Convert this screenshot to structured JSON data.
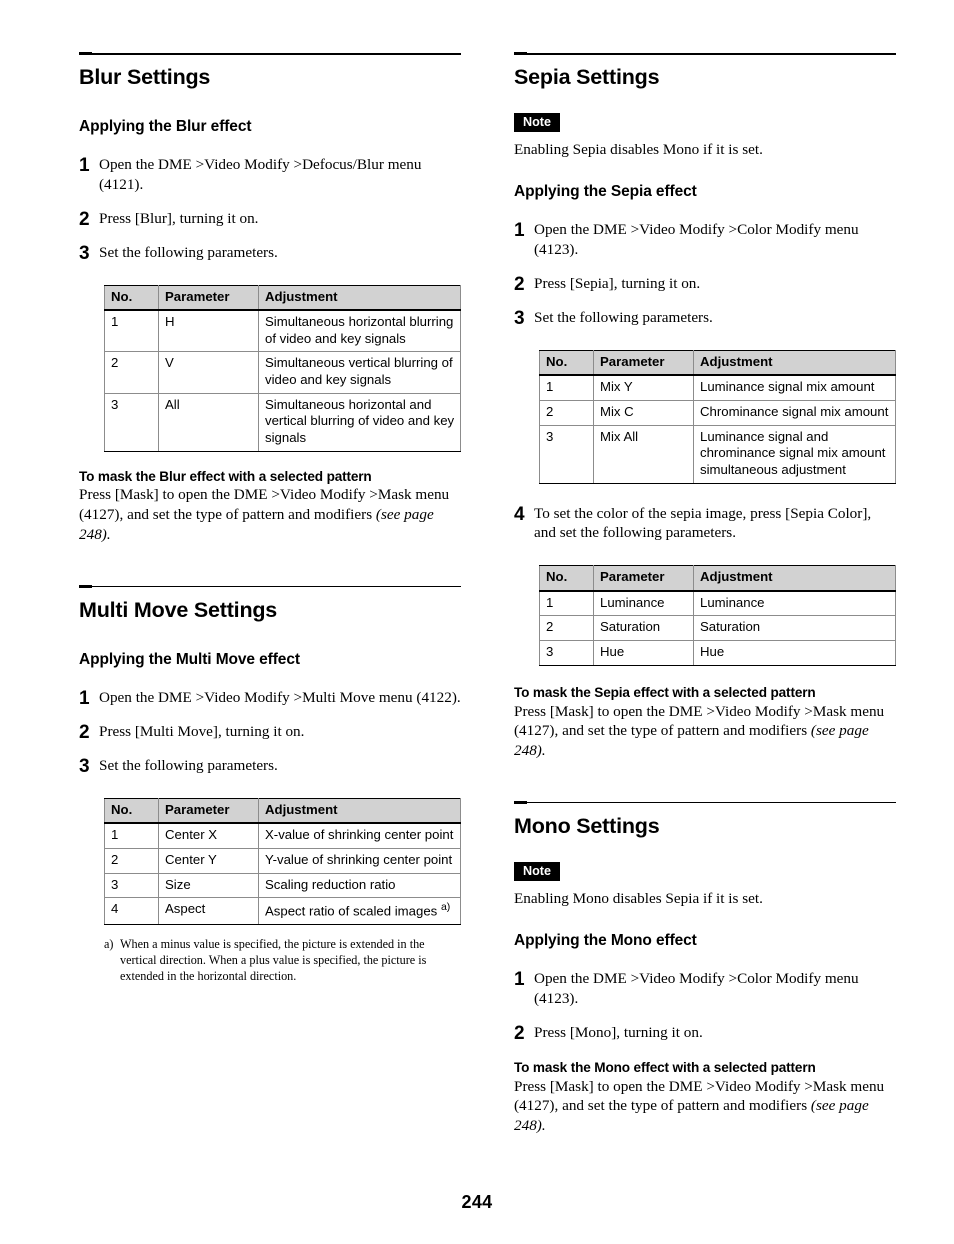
{
  "page": {
    "number": "244"
  },
  "left_column": {
    "blur": {
      "title": "Blur Settings",
      "applying_heading": "Applying the Blur effect",
      "steps": [
        {
          "num": "1",
          "text": "Open the DME >Video Modify >Defocus/Blur menu (4121)."
        },
        {
          "num": "2",
          "text": "Press [Blur], turning it on."
        },
        {
          "num": "3",
          "text": "Set the following parameters."
        }
      ],
      "table": {
        "headers": [
          "No.",
          "Parameter",
          "Adjustment"
        ],
        "rows": [
          [
            "1",
            "H",
            "Simultaneous horizontal blurring of video and key signals"
          ],
          [
            "2",
            "V",
            "Simultaneous vertical blurring of video and key signals"
          ],
          [
            "3",
            "All",
            "Simultaneous horizontal and vertical blurring of video and key signals"
          ]
        ]
      },
      "mask_heading": "To mask the Blur effect with a selected pattern",
      "mask_text": "Press [Mask] to open the DME >Video Modify >Mask menu (4127), and set the type of pattern and modifiers ",
      "mask_ref": "(see page 248)."
    },
    "multi_move": {
      "title": "Multi Move Settings",
      "applying_heading": "Applying the Multi Move effect",
      "steps": [
        {
          "num": "1",
          "text": "Open the DME >Video Modify >Multi Move menu (4122)."
        },
        {
          "num": "2",
          "text": "Press [Multi Move], turning it on."
        },
        {
          "num": "3",
          "text": "Set the following parameters."
        }
      ],
      "table": {
        "headers": [
          "No.",
          "Parameter",
          "Adjustment"
        ],
        "rows": [
          [
            "1",
            "Center X",
            "X-value of shrinking center point",
            ""
          ],
          [
            "2",
            "Center Y",
            "Y-value of shrinking center point",
            ""
          ],
          [
            "3",
            "Size",
            "Scaling reduction ratio",
            ""
          ],
          [
            "4",
            "Aspect",
            "Aspect ratio of scaled images",
            "a)"
          ]
        ]
      },
      "footnote": {
        "mark": "a)",
        "text": "When a minus value is specified, the picture is extended in the vertical direction. When a plus value is specified, the picture is extended in the horizontal direction."
      }
    }
  },
  "right_column": {
    "sepia": {
      "title": "Sepia Settings",
      "note_badge": "Note",
      "note_text": "Enabling Sepia disables Mono if it is set.",
      "applying_heading": "Applying the Sepia effect",
      "steps": [
        {
          "num": "1",
          "text": "Open the DME >Video Modify >Color Modify menu (4123)."
        },
        {
          "num": "2",
          "text": "Press [Sepia], turning it on."
        },
        {
          "num": "3",
          "text": "Set the following parameters."
        }
      ],
      "table": {
        "headers": [
          "No.",
          "Parameter",
          "Adjustment"
        ],
        "rows": [
          [
            "1",
            "Mix Y",
            "Luminance signal mix amount"
          ],
          [
            "2",
            "Mix C",
            "Chrominance signal mix amount"
          ],
          [
            "3",
            "Mix All",
            "Luminance signal and chrominance signal mix amount simultaneous adjustment"
          ]
        ]
      },
      "step4": {
        "num": "4",
        "text": "To set the color of the sepia image, press [Sepia Color], and set the following parameters."
      },
      "table2": {
        "headers": [
          "No.",
          "Parameter",
          "Adjustment"
        ],
        "rows": [
          [
            "1",
            "Luminance",
            "Luminance"
          ],
          [
            "2",
            "Saturation",
            "Saturation"
          ],
          [
            "3",
            "Hue",
            "Hue"
          ]
        ]
      },
      "mask_heading": "To mask the Sepia effect with a selected pattern",
      "mask_text": "Press [Mask] to open the DME >Video Modify >Mask menu (4127), and set the type of pattern and modifiers ",
      "mask_ref": "(see page 248)."
    },
    "mono": {
      "title": "Mono Settings",
      "note_badge": "Note",
      "note_text": "Enabling Mono disables Sepia if it is set.",
      "applying_heading": "Applying the Mono effect",
      "steps": [
        {
          "num": "1",
          "text": "Open the DME >Video Modify >Color Modify menu (4123)."
        },
        {
          "num": "2",
          "text": "Press [Mono], turning it on."
        }
      ],
      "mask_heading": "To mask the Mono effect with a selected pattern",
      "mask_text": "Press [Mask] to open the DME >Video Modify >Mask menu (4127), and set the type of pattern and modifiers ",
      "mask_ref": "(see page 248)."
    }
  }
}
